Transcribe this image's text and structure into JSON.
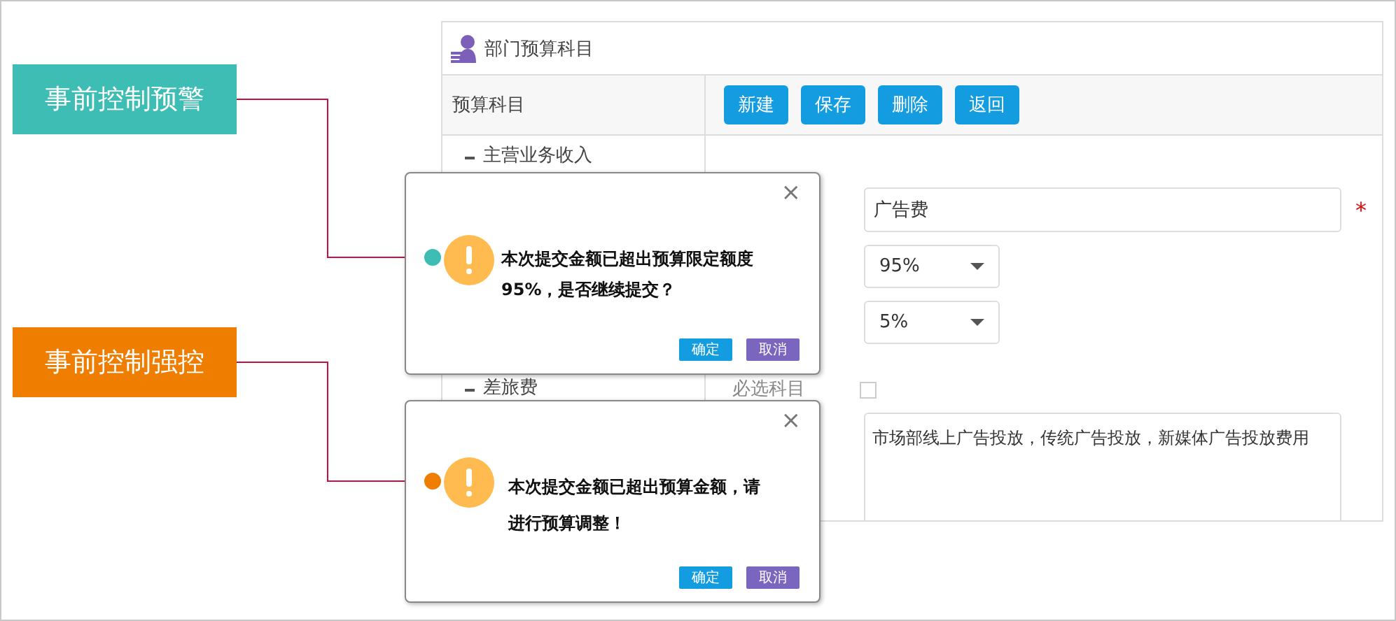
{
  "panel": {
    "title": "部门预算科目",
    "tree_header": "预算科目",
    "buttons": [
      "新建",
      "保存",
      "删除",
      "返回"
    ],
    "tree_items": [
      {
        "label": "主营业务收入",
        "expanded": true
      },
      {
        "label": "差旅费",
        "expanded": true
      }
    ]
  },
  "form": {
    "name_value": "广告费",
    "required_mark": "*",
    "select_1": "95%",
    "select_2": "5%",
    "required_label": "必选科目",
    "required_checked": false,
    "description": "市场部线上广告投放，传统广告投放，新媒体广告投放费用"
  },
  "dialogs": [
    {
      "message": "本次提交金额已超出预算限定额度95%，是否继续提交？",
      "buttons": [
        "确定",
        "取消"
      ],
      "close": "×"
    },
    {
      "message": "本次提交金额已超出预算金额，请进行预算调整！",
      "buttons": [
        "确定",
        "取消"
      ],
      "close": "×"
    }
  ],
  "callouts": [
    {
      "label": "事前控制预警",
      "color": "#3dbdb3"
    },
    {
      "label": "事前控制强控",
      "color": "#ef7d00"
    }
  ]
}
